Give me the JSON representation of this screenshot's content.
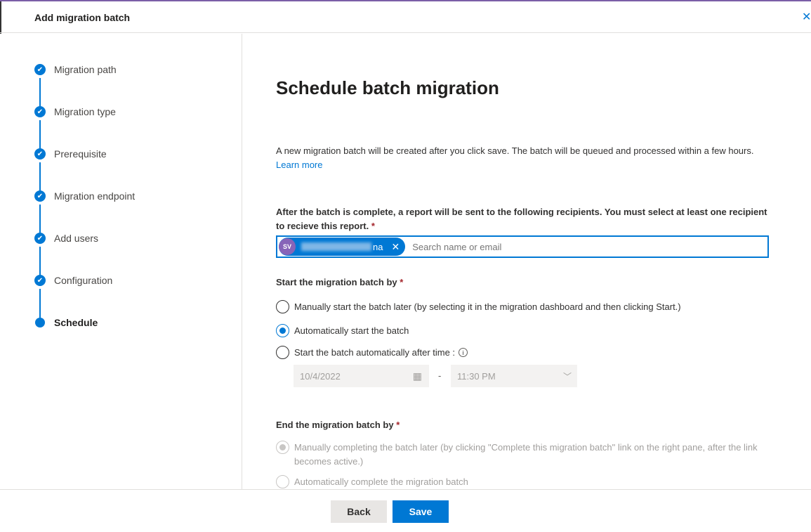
{
  "header": {
    "title": "Add migration batch",
    "close_icon": "close-icon"
  },
  "steps": [
    {
      "label": "Migration path",
      "done": true
    },
    {
      "label": "Migration type",
      "done": true
    },
    {
      "label": "Prerequisite",
      "done": true
    },
    {
      "label": "Migration endpoint",
      "done": true
    },
    {
      "label": "Add users",
      "done": true
    },
    {
      "label": "Configuration",
      "done": true
    },
    {
      "label": "Schedule",
      "done": false,
      "current": true
    }
  ],
  "main": {
    "heading": "Schedule batch migration",
    "intro": "A new migration batch will be created after you click save. The batch will be queued and processed within a few hours.",
    "learn_more": "Learn more",
    "recipients_label": "After the batch is complete, a report will be sent to the following recipients. You must select at least one recipient to recieve this report.",
    "required_mark": "*",
    "recipient": {
      "initials": "SV",
      "name_suffix": "na"
    },
    "search_placeholder": "Search name or email",
    "start_label": "Start the migration batch by",
    "start_options": [
      "Manually start the batch later (by selecting it in the migration dashboard and then clicking Start.)",
      "Automatically start the batch",
      "Start the batch automatically after time :"
    ],
    "start_selected": 1,
    "date": "10/4/2022",
    "separator": "-",
    "time": "11:30 PM",
    "end_label": "End the migration batch by",
    "end_options": [
      "Manually completing the batch later (by clicking \"Complete this migration batch\" link on the right pane, after the link becomes active.)",
      "Automatically complete the migration batch"
    ],
    "end_selected": 0
  },
  "footer": {
    "back": "Back",
    "save": "Save"
  },
  "colors": {
    "accent": "#0078d4",
    "avatar": "#8764b8"
  }
}
